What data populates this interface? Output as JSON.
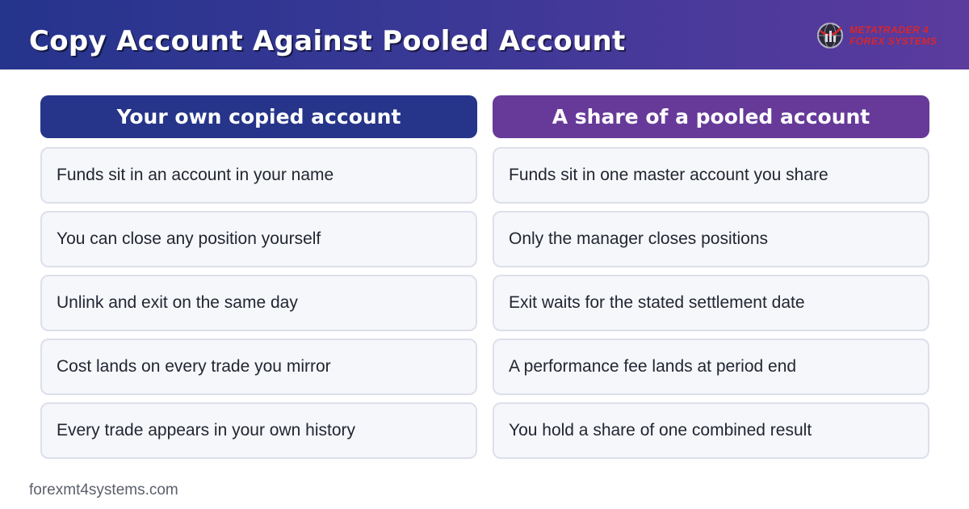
{
  "header": {
    "title": "Copy Account Against Pooled Account",
    "logo": {
      "icon": "globe-chart-icon",
      "line1": "METATRADER 4",
      "line2": "FOREX SYSTEMS",
      "text_color": "#d9262c"
    }
  },
  "columns": [
    {
      "title": "Your own copied account",
      "color": "#263589",
      "rows": [
        "Funds sit in an account in your name",
        "You can close any position yourself",
        "Unlink and exit on the same day",
        "Cost lands on every trade you mirror",
        "Every trade appears in your own history"
      ]
    },
    {
      "title": "A share of a pooled account",
      "color": "#673a99",
      "rows": [
        "Funds sit in one master account you share",
        "Only the manager closes positions",
        "Exit waits for the stated settlement date",
        "A performance fee lands at period end",
        "You hold a share of one combined result"
      ]
    }
  ],
  "footer": {
    "site": "forexmt4systems.com"
  }
}
